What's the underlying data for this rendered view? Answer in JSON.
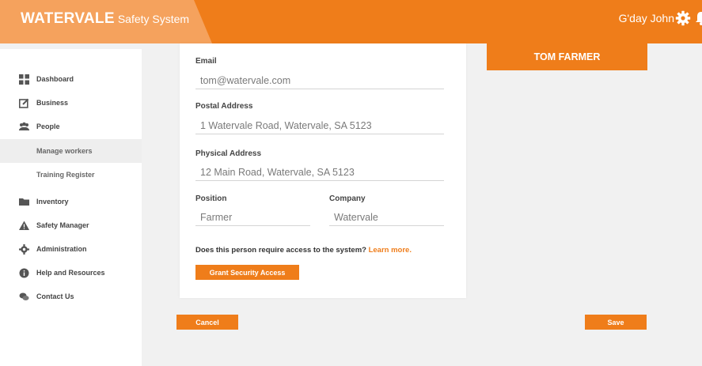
{
  "header": {
    "brand_bold": "WATERVALE",
    "brand_light": "Safety System",
    "greeting": "G'day John",
    "accent_color": "#ef7d1a",
    "brand_panel_color": "#f5a25d"
  },
  "sidebar": {
    "items": [
      {
        "label": "Dashboard",
        "icon": "dashboard-icon"
      },
      {
        "label": "Business",
        "icon": "edit-icon"
      },
      {
        "label": "People",
        "icon": "people-icon"
      },
      {
        "label": "Manage workers",
        "icon": ""
      },
      {
        "label": "Training Register",
        "icon": ""
      },
      {
        "label": "Inventory",
        "icon": "folder-icon"
      },
      {
        "label": "Safety Manager",
        "icon": "warning-icon"
      },
      {
        "label": "Administration",
        "icon": "gear-icon"
      },
      {
        "label": "Help and Resources",
        "icon": "info-icon"
      },
      {
        "label": "Contact Us",
        "icon": "chat-icon"
      }
    ],
    "active": "Manage workers"
  },
  "form": {
    "email_label": "Email",
    "email_value": "tom@watervale.com",
    "postal_label": "Postal Address",
    "postal_value": "1 Watervale Road, Watervale, SA 5123",
    "physical_label": "Physical Address",
    "physical_value": "12 Main Road, Watervale, SA 5123",
    "position_label": "Position",
    "position_value": "Farmer",
    "company_label": "Company",
    "company_value": "Watervale",
    "access_question": "Does this person require access to the system?",
    "learn_more": "Learn more.",
    "grant_button": "Grant Security Access"
  },
  "profile": {
    "name": "TOM FARMER"
  },
  "actions": {
    "cancel": "Cancel",
    "save": "Save"
  }
}
